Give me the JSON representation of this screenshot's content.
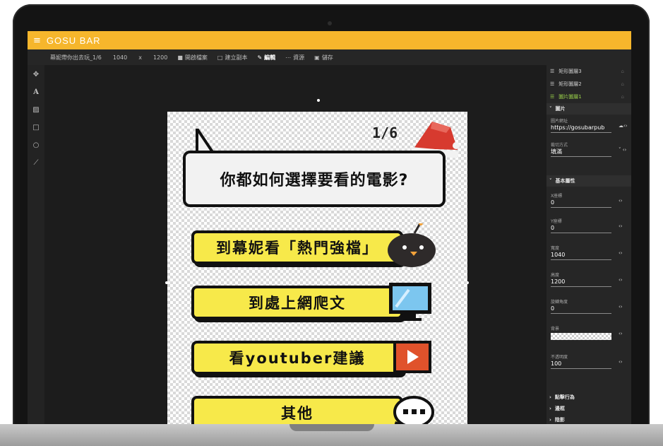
{
  "app": {
    "title": "GOSU BAR",
    "menu_icon": "hamburger-icon"
  },
  "toolbar": {
    "filename": "幕妮帶你出去玩_1/6",
    "width": "1040",
    "x_label": "x",
    "height": "1200",
    "open_file": "開啟檔案",
    "create_copy": "建立副本",
    "edit": "編輯",
    "resources": "資源",
    "save": "儲存"
  },
  "artboard": {
    "page_counter": "1/6",
    "question": "你都如何選擇要看的電影?",
    "options": [
      {
        "label": "到幕妮看「熱門強檔」",
        "icon": "black-bird-icon"
      },
      {
        "label": "到處上網爬文",
        "icon": "computer-monitor-icon"
      },
      {
        "label": "看youtuber建議",
        "icon": "play-button-icon",
        "icon_color": "#e0522b"
      },
      {
        "label": "其他",
        "icon": "speech-bubble-ellipsis-icon"
      }
    ],
    "bar_color": "#f7e94a"
  },
  "layers": [
    {
      "label": "矩形圖層3",
      "selected": false
    },
    {
      "label": "矩形圖層2",
      "selected": false
    },
    {
      "label": "圖片圖層1",
      "selected": true
    }
  ],
  "panel": {
    "image_section": "圖片",
    "image_url_label": "圖片網址",
    "image_url_value": "https://gosubarpub",
    "crop_label": "裁切方式",
    "crop_value": "填滿",
    "basic_section": "基本屬性",
    "x_label": "X座標",
    "x_value": "0",
    "y_label": "Y座標",
    "y_value": "0",
    "width_label": "寬度",
    "width_value": "1040",
    "height_label": "高度",
    "height_value": "1200",
    "rotation_label": "旋轉角度",
    "rotation_value": "0",
    "bg_label": "背景",
    "opacity_label": "不透明度",
    "opacity_value": "100",
    "click_section": "點擊行為",
    "border_section": "邊框",
    "shadow_section": "陰影"
  },
  "colors": {
    "accent": "#f6b62c",
    "selected_layer": "#9ad14a",
    "panel_bg": "#262626"
  }
}
